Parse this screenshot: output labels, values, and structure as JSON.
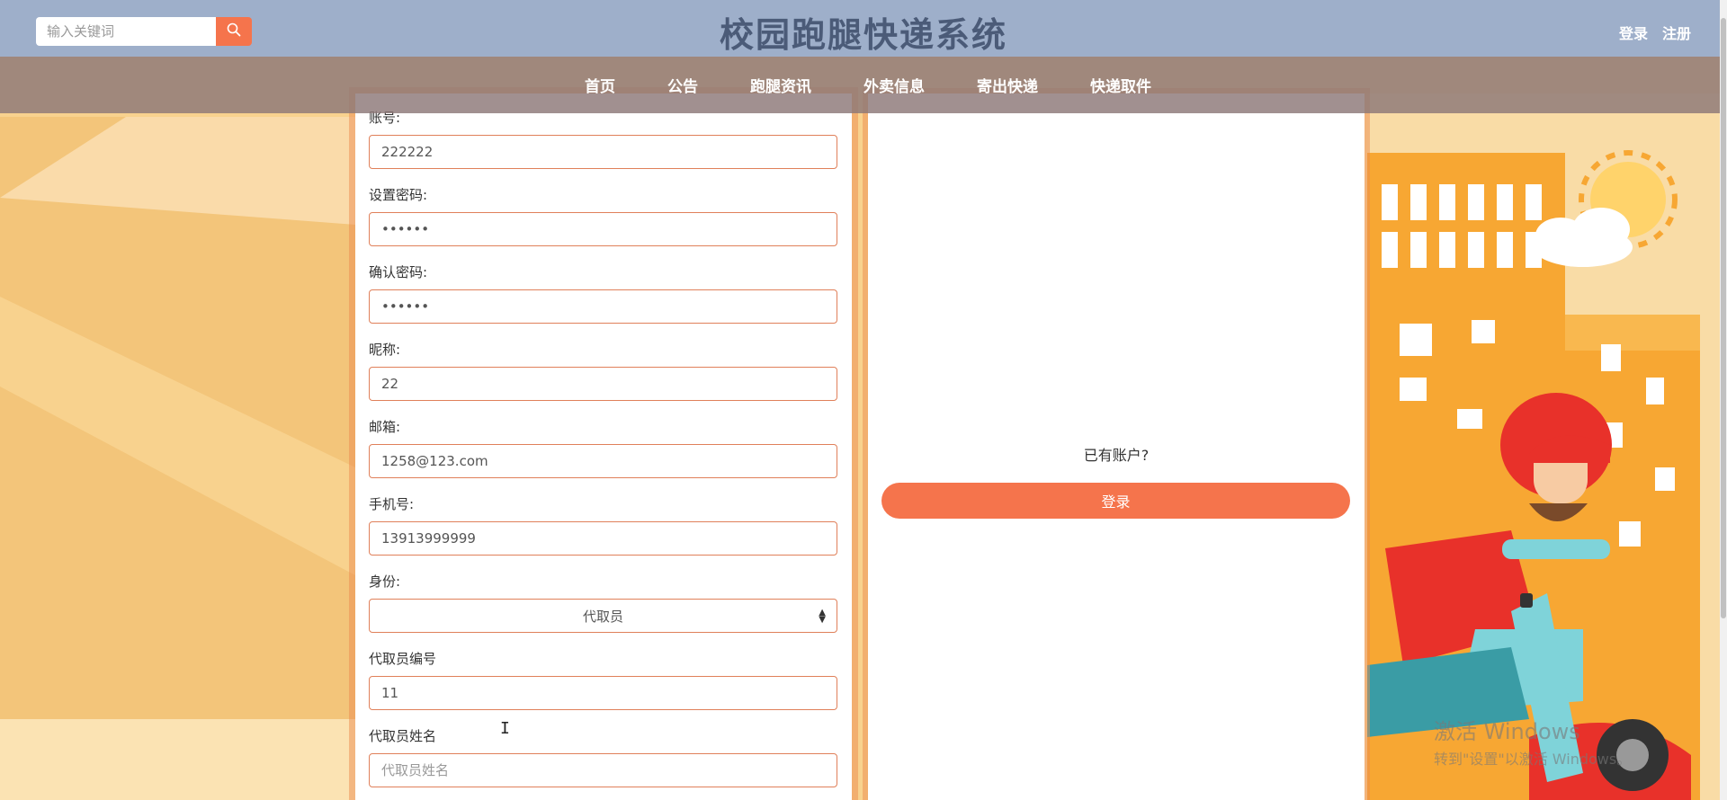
{
  "header": {
    "search_placeholder": "输入关键词",
    "site_title": "校园跑腿快递系统",
    "login_link": "登录",
    "register_link": "注册"
  },
  "nav": {
    "items": [
      {
        "label": "首页"
      },
      {
        "label": "公告"
      },
      {
        "label": "跑腿资讯"
      },
      {
        "label": "外卖信息"
      },
      {
        "label": "寄出快递"
      },
      {
        "label": "快递取件"
      }
    ]
  },
  "form": {
    "account": {
      "label": "账号:",
      "value": "222222"
    },
    "password": {
      "label": "设置密码:",
      "value": "••••••"
    },
    "confirm_password": {
      "label": "确认密码:",
      "value": "••••••"
    },
    "nickname": {
      "label": "昵称:",
      "value": "22"
    },
    "email": {
      "label": "邮箱:",
      "value": "1258@123.com"
    },
    "phone": {
      "label": "手机号:",
      "value": "13913999999"
    },
    "role": {
      "label": "身份:",
      "selected": "代取员"
    },
    "courier_id": {
      "label": "代取员编号",
      "value": "11"
    },
    "courier_name": {
      "label": "代取员姓名",
      "placeholder": "代取员姓名"
    }
  },
  "side": {
    "have_account_text": "已有账户?",
    "login_button": "登录"
  },
  "watermark": {
    "title": "激活 Windows",
    "subtitle": "转到\"设置\"以激活 Windows。"
  },
  "icons": {
    "search": "search-icon",
    "select_arrow": "select-arrows-icon",
    "cursor": "text-cursor-icon"
  },
  "colors": {
    "header_bg": "#9eafca",
    "accent": "#f5744c",
    "title_color": "#4b5b78"
  }
}
